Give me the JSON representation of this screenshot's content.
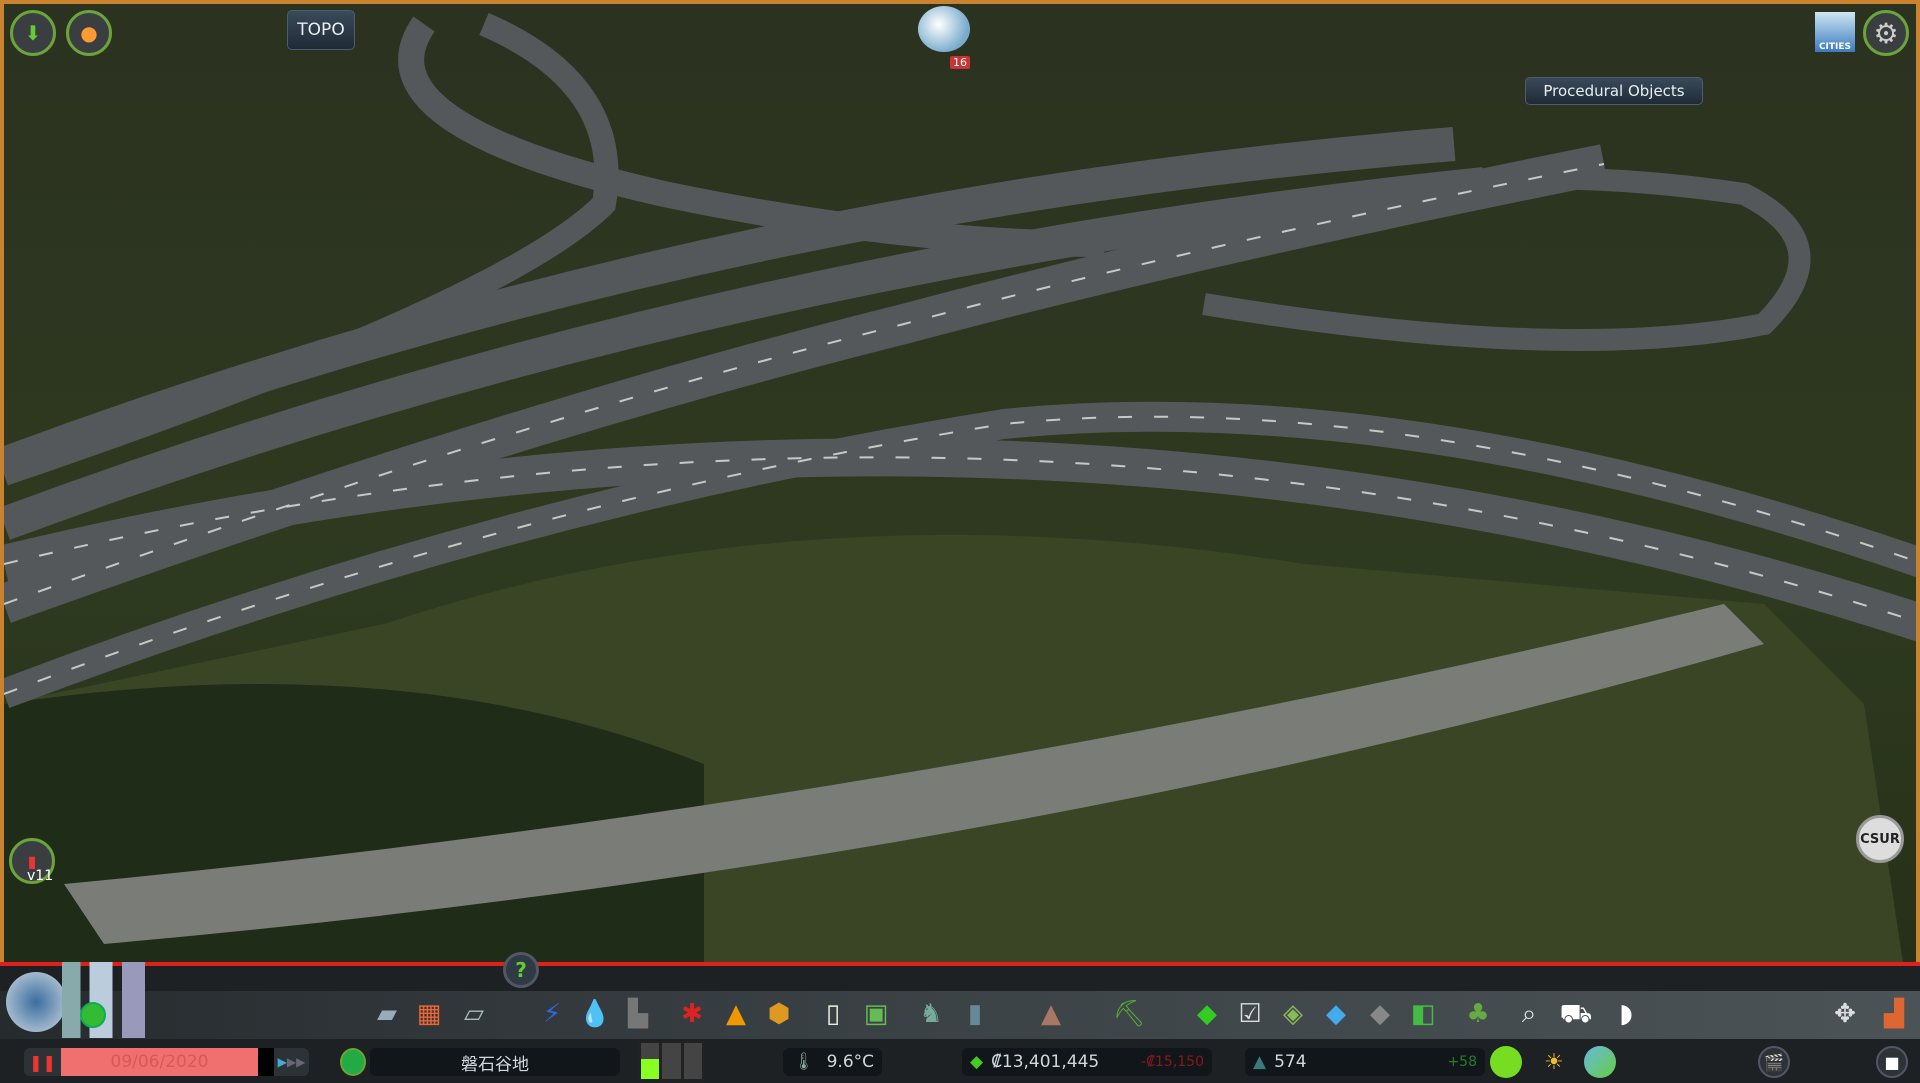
{
  "top_left": {
    "buttons": [
      {
        "name": "terrain-tool",
        "icon": "terrain-icon"
      },
      {
        "name": "fire-info",
        "icon": "fire-icon"
      }
    ],
    "topo_label": "TOPO"
  },
  "chirper": {
    "badge": "16",
    "icon": "chirper-bird-icon"
  },
  "top_right": {
    "logo": "CITIES",
    "settings_icon": "gear-icon",
    "procedural_objects_label": "Procedural Objects"
  },
  "traffic_mod": {
    "label": "v11",
    "icon": "traffic-light-icon"
  },
  "csur_label": "CSUR",
  "help_label": "?",
  "toolbar": {
    "icons": [
      "roads-icon",
      "zoning-icon",
      "districts-icon",
      "electricity-icon",
      "water-icon",
      "garbage-icon",
      "healthcare-icon",
      "fire-department-icon",
      "police-icon",
      "education-icon",
      "public-transport-icon",
      "parks-icon",
      "monuments-icon",
      "unique-buildings-icon",
      "landscaping-icon",
      "money-icon",
      "policies-icon",
      "resources-icon",
      "water-surface-icon",
      "terrain-icon",
      "areas-icon",
      "trees-icon",
      "search-icon",
      "traffic-icon",
      "map-outline-icon",
      "move-it-icon",
      "bulldozer-icon"
    ]
  },
  "status": {
    "date": "09/06/2020",
    "city_name": "磐石谷地",
    "temperature": "9.6°C",
    "money": "₡13,401,445",
    "money_change": "-₡15,150",
    "population": "574",
    "population_change": "+58",
    "speed_level": 1,
    "demand": {
      "residential": 0.55,
      "commercial": 0,
      "industrial": 0
    }
  },
  "colors": {
    "border": "#c9822e",
    "alert_line": "#e0201a",
    "date_bar": "#f07070",
    "accent_green": "#6aa43a"
  }
}
